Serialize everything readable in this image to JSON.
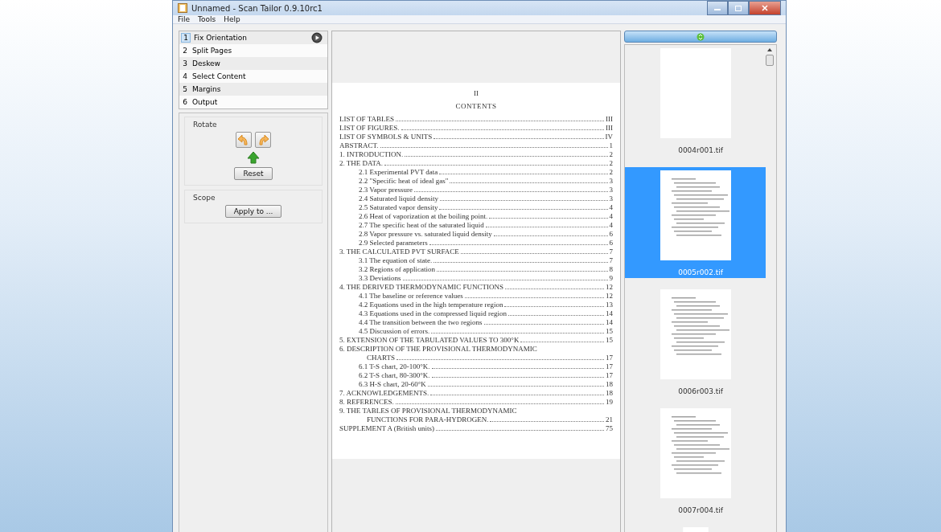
{
  "window": {
    "title": "Unnamed - Scan Tailor 0.9.10rc1"
  },
  "menu": [
    "File",
    "Tools",
    "Help"
  ],
  "steps": [
    {
      "number": "1",
      "label": "Fix Orientation",
      "selected": true
    },
    {
      "number": "2",
      "label": "Split Pages",
      "selected": false
    },
    {
      "number": "3",
      "label": "Deskew",
      "selected": false
    },
    {
      "number": "4",
      "label": "Select Content",
      "selected": false
    },
    {
      "number": "5",
      "label": "Margins",
      "selected": false
    },
    {
      "number": "6",
      "label": "Output",
      "selected": false
    }
  ],
  "rotate": {
    "title": "Rotate",
    "reset": "Reset"
  },
  "scope": {
    "title": "Scope",
    "apply": "Apply to ..."
  },
  "page": {
    "number": "II",
    "heading": "CONTENTS",
    "entries": [
      {
        "lines": [
          "LIST OF TABLES"
        ],
        "page": "III"
      },
      {
        "lines": [
          "LIST OF FIGURES."
        ],
        "page": "III"
      },
      {
        "lines": [
          "LIST OF SYMBOLS & UNITS"
        ],
        "page": "IV"
      },
      {
        "lines": [
          "ABSTRACT."
        ],
        "page": "1"
      },
      {
        "lines": [
          "1.  INTRODUCTION."
        ],
        "page": "2"
      },
      {
        "lines": [
          "2.  THE DATA."
        ],
        "page": "2",
        "children": [
          {
            "lines": [
              "2.1  Experimental PVT data"
            ],
            "page": "2"
          },
          {
            "lines": [
              "2.2  \"Specific heat of ideal gas\""
            ],
            "page": "3"
          },
          {
            "lines": [
              "2.3  Vapor pressure"
            ],
            "page": "3"
          },
          {
            "lines": [
              "2.4  Saturated liquid density"
            ],
            "page": "3"
          },
          {
            "lines": [
              "2.5  Saturated vapor density"
            ],
            "page": "4"
          },
          {
            "lines": [
              "2.6  Heat of vaporization at the boiling point."
            ],
            "page": "4"
          },
          {
            "lines": [
              "2.7  The specific heat of the saturated liquid"
            ],
            "page": "4"
          },
          {
            "lines": [
              "2.8  Vapor pressure vs. saturated liquid density"
            ],
            "page": "6"
          },
          {
            "lines": [
              "2.9  Selected parameters"
            ],
            "page": "6"
          }
        ]
      },
      {
        "lines": [
          "3.  THE CALCULATED PVT SURFACE"
        ],
        "page": "7",
        "children": [
          {
            "lines": [
              "3.1  The equation of state."
            ],
            "page": "7"
          },
          {
            "lines": [
              "3.2  Regions of application"
            ],
            "page": "8"
          },
          {
            "lines": [
              "3.3  Deviations"
            ],
            "page": "9"
          }
        ]
      },
      {
        "lines": [
          "4.  THE DERIVED THERMODYNAMIC FUNCTIONS"
        ],
        "page": "12",
        "children": [
          {
            "lines": [
              "4.1  The baseline or reference values"
            ],
            "page": "12"
          },
          {
            "lines": [
              "4.2  Equations used in the high temperature region"
            ],
            "page": "13"
          },
          {
            "lines": [
              "4.3  Equations used in the compressed liquid region"
            ],
            "page": "14"
          },
          {
            "lines": [
              "4.4  The transition between the two regions"
            ],
            "page": "14"
          },
          {
            "lines": [
              "4.5  Discussion of errors."
            ],
            "page": "15"
          }
        ]
      },
      {
        "lines": [
          "5.  EXTENSION OF THE TABULATED VALUES TO 300°K"
        ],
        "page": "15"
      },
      {
        "lines": [
          "6.  DESCRIPTION OF THE PROVISIONAL THERMODYNAMIC",
          "CHARTS"
        ],
        "page": "17",
        "children": [
          {
            "lines": [
              "6.1  T-S chart, 20-100°K."
            ],
            "page": "17"
          },
          {
            "lines": [
              "6.2  T-S chart, 80-300°K."
            ],
            "page": "17"
          },
          {
            "lines": [
              "6.3  H-S chart, 20-60°K"
            ],
            "page": "18"
          }
        ]
      },
      {
        "lines": [
          "7.  ACKNOWLEDGEMENTS."
        ],
        "page": "18"
      },
      {
        "lines": [
          "8.  REFERENCES."
        ],
        "page": "19"
      },
      {
        "lines": [
          "9.  THE TABLES OF PROVISIONAL THERMODYNAMIC",
          "FUNCTIONS FOR PARA-HYDROGEN."
        ],
        "page": "21"
      },
      {
        "lines": [
          "SUPPLEMENT A  (British units)"
        ],
        "page": "75"
      }
    ]
  },
  "thumbnails": [
    {
      "filename": "0004r001.tif",
      "selected": false,
      "kind": "blank"
    },
    {
      "filename": "0005r002.tif",
      "selected": true,
      "kind": "text"
    },
    {
      "filename": "0006r003.tif",
      "selected": false,
      "kind": "text"
    },
    {
      "filename": "0007r004.tif",
      "selected": false,
      "kind": "text"
    },
    {
      "kind": "blank",
      "selected": false
    }
  ]
}
